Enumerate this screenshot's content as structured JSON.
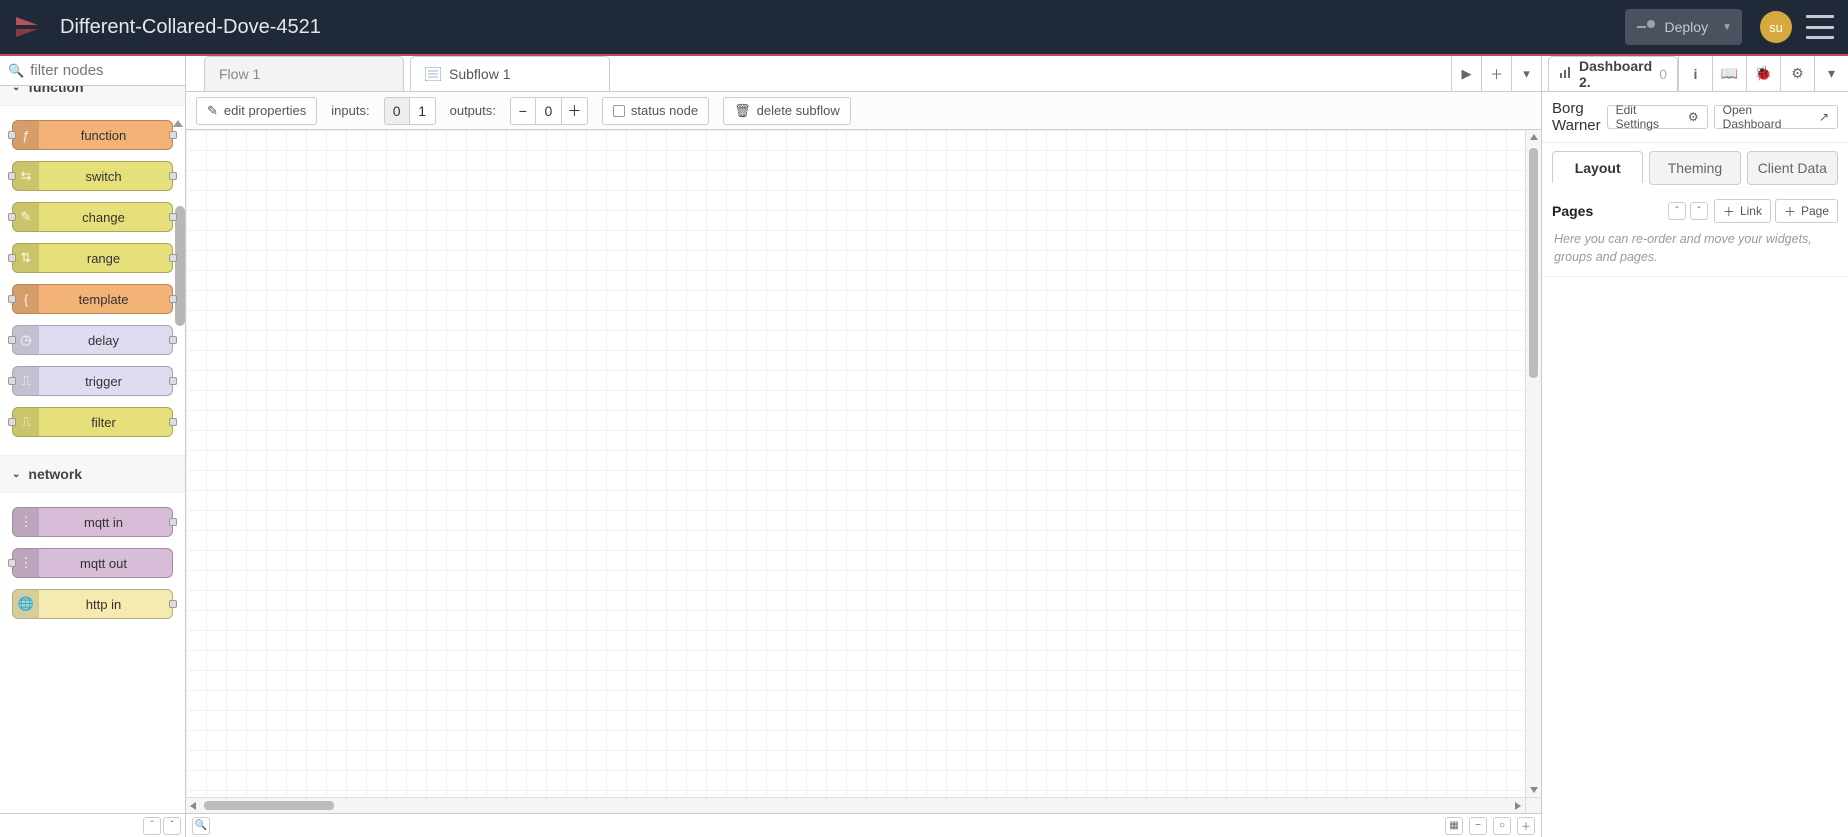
{
  "header": {
    "title": "Different-Collared-Dove-4521",
    "deploy_label": "Deploy",
    "avatar_initials": "su"
  },
  "palette": {
    "search_placeholder": "filter nodes",
    "categories": [
      {
        "name": "function",
        "nodes": [
          {
            "label": "function",
            "style": "n-orange",
            "icon": "ƒ",
            "ports": "both"
          },
          {
            "label": "switch",
            "style": "n-yellow",
            "icon": "⇆",
            "ports": "both"
          },
          {
            "label": "change",
            "style": "n-yellow",
            "icon": "✎",
            "ports": "both"
          },
          {
            "label": "range",
            "style": "n-yellow",
            "icon": "⇅",
            "ports": "both"
          },
          {
            "label": "template",
            "style": "n-orange",
            "icon": "{",
            "ports": "both"
          },
          {
            "label": "delay",
            "style": "n-lav",
            "icon": "◷",
            "ports": "both"
          },
          {
            "label": "trigger",
            "style": "n-lav",
            "icon": "⎍",
            "ports": "both"
          },
          {
            "label": "filter",
            "style": "n-yellow",
            "icon": "⎍",
            "ports": "both"
          }
        ]
      },
      {
        "name": "network",
        "nodes": [
          {
            "label": "mqtt in",
            "style": "n-mauve",
            "icon": "⋮",
            "ports": "out"
          },
          {
            "label": "mqtt out",
            "style": "n-mauve",
            "icon": "⋮",
            "ports": "in"
          },
          {
            "label": "http in",
            "style": "n-cream",
            "icon": "🌐",
            "ports": "out"
          }
        ]
      }
    ]
  },
  "workspace": {
    "tabs": [
      {
        "label": "Flow 1",
        "active": false
      },
      {
        "label": "Subflow 1",
        "active": true
      }
    ],
    "toolbar": {
      "edit_properties": "edit properties",
      "inputs_label": "inputs:",
      "inputs_value": "0",
      "inputs_alt": "1",
      "outputs_label": "outputs:",
      "outputs_value": "0",
      "status_node": "status node",
      "delete_subflow": "delete subflow"
    }
  },
  "sidebar": {
    "title_main": "Dashboard 2.",
    "title_dim": "0",
    "project_name": "Borg Warner",
    "edit_settings": "Edit Settings",
    "open_dashboard": "Open Dashboard",
    "segments": {
      "layout": "Layout",
      "theming": "Theming",
      "client_data": "Client Data"
    },
    "pages_title": "Pages",
    "link_btn": "Link",
    "page_btn": "Page",
    "help_text": "Here you can re-order and move your widgets, groups and pages."
  }
}
